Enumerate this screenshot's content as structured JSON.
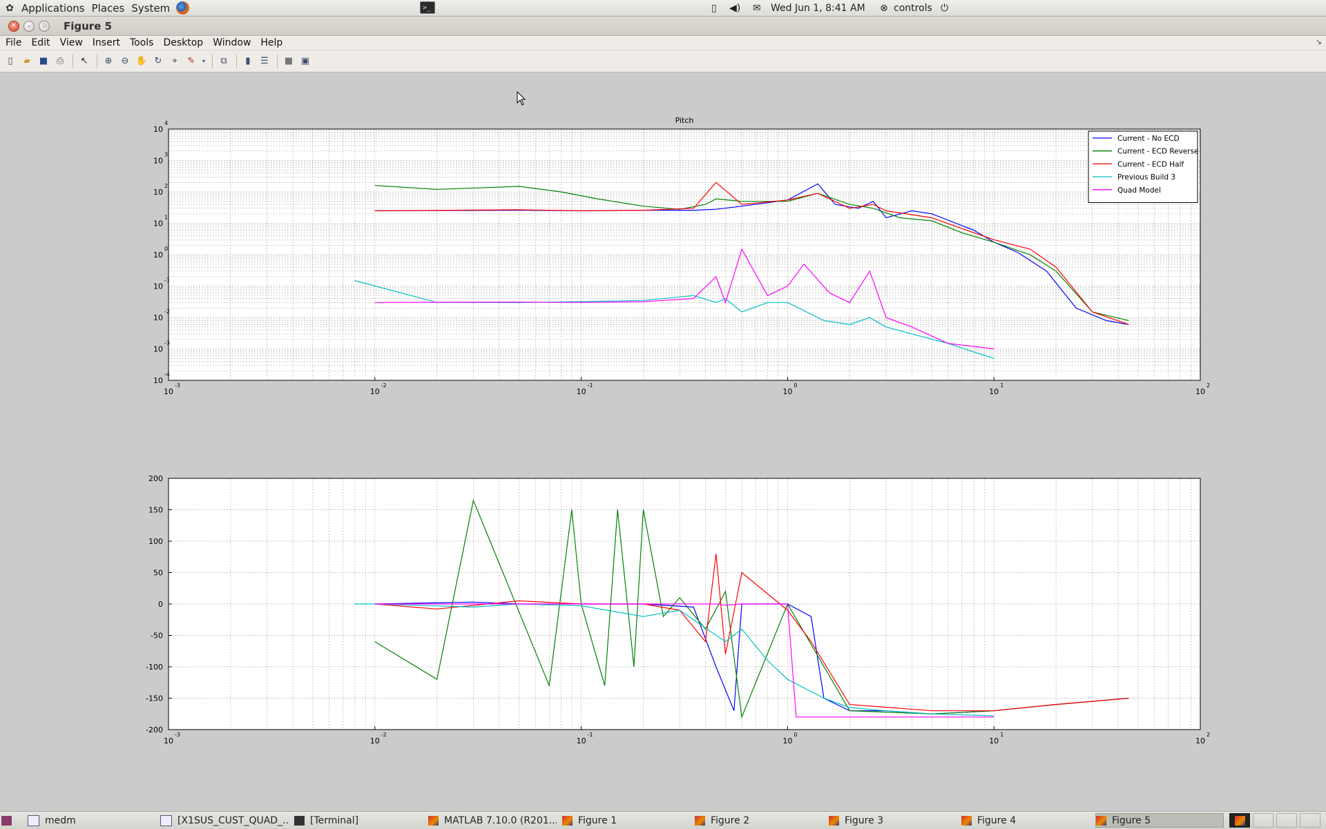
{
  "top_panel": {
    "menus": [
      "Applications",
      "Places",
      "System"
    ],
    "clock": "Wed Jun  1,  8:41 AM",
    "user": "controls"
  },
  "window": {
    "title": "Figure 5"
  },
  "menubar": [
    "File",
    "Edit",
    "View",
    "Insert",
    "Tools",
    "Desktop",
    "Window",
    "Help"
  ],
  "toolbar_icons": [
    "new-figure-icon",
    "open-file-icon",
    "save-icon",
    "print-icon",
    "edit-plot-icon",
    "zoom-in-icon",
    "zoom-out-icon",
    "pan-icon",
    "rotate-3d-icon",
    "data-cursor-icon",
    "brush-icon",
    "link-plot-icon",
    "colorbar-icon",
    "legend-icon",
    "hide-plot-tools-icon",
    "show-plot-tools-icon"
  ],
  "taskbar": {
    "items": [
      "medm",
      "[X1SUS_CUST_QUAD_...",
      "[Terminal]",
      "MATLAB  7.10.0 (R201...",
      "Figure 1",
      "Figure 2",
      "Figure 3",
      "Figure 4",
      "Figure 5"
    ],
    "active": "Figure 5"
  },
  "chart_data": [
    {
      "type": "line",
      "title": "Pitch",
      "xscale": "log",
      "yscale": "log",
      "xlim": [
        0.001,
        100
      ],
      "ylim": [
        0.0001,
        10000
      ],
      "grid": true,
      "legend_position": "top-right",
      "xticks": [
        {
          "base": "10",
          "exp": "-3"
        },
        {
          "base": "10",
          "exp": "-2"
        },
        {
          "base": "10",
          "exp": "-1"
        },
        {
          "base": "10",
          "exp": "0"
        },
        {
          "base": "10",
          "exp": "1"
        },
        {
          "base": "10",
          "exp": "2"
        }
      ],
      "yticks": [
        {
          "base": "10",
          "exp": "-4"
        },
        {
          "base": "10",
          "exp": "-3"
        },
        {
          "base": "10",
          "exp": "-2"
        },
        {
          "base": "10",
          "exp": "-1"
        },
        {
          "base": "10",
          "exp": "0"
        },
        {
          "base": "10",
          "exp": "1"
        },
        {
          "base": "10",
          "exp": "2"
        },
        {
          "base": "10",
          "exp": "3"
        },
        {
          "base": "10",
          "exp": "4"
        }
      ],
      "series": [
        {
          "name": "Current - No ECD",
          "color": "#0000ff",
          "x": [
            0.01,
            0.05,
            0.1,
            0.2,
            0.35,
            0.45,
            0.6,
            1.0,
            1.4,
            1.7,
            2.2,
            2.6,
            3.0,
            4.0,
            5.0,
            8.0,
            10.0,
            13.0,
            18.0,
            25.0,
            35.0,
            45.0
          ],
          "y": [
            25,
            26,
            25,
            26,
            26,
            28,
            35,
            55,
            180,
            40,
            30,
            50,
            15,
            25,
            20,
            6,
            2.5,
            1.2,
            0.3,
            0.02,
            0.008,
            0.006
          ]
        },
        {
          "name": "Current - ECD Reverse",
          "color": "#008000",
          "x": [
            0.01,
            0.02,
            0.05,
            0.08,
            0.12,
            0.2,
            0.3,
            0.4,
            0.45,
            0.6,
            1.0,
            1.4,
            2.0,
            2.6,
            3.5,
            5.0,
            7.0,
            10.0,
            15.0,
            20.0,
            30.0,
            45.0
          ],
          "y": [
            160,
            120,
            150,
            100,
            60,
            35,
            28,
            40,
            60,
            50,
            50,
            90,
            40,
            30,
            15,
            12,
            5,
            2.5,
            1,
            0.3,
            0.015,
            0.008
          ]
        },
        {
          "name": "Current - ECD Half",
          "color": "#ff0000",
          "x": [
            0.01,
            0.05,
            0.1,
            0.2,
            0.35,
            0.45,
            0.6,
            1.0,
            1.4,
            2.0,
            2.6,
            3.0,
            5.0,
            8.0,
            10.0,
            15.0,
            20.0,
            30.0,
            45.0
          ],
          "y": [
            25,
            27,
            25,
            26,
            30,
            200,
            40,
            55,
            90,
            30,
            40,
            25,
            15,
            5,
            3,
            1.5,
            0.4,
            0.015,
            0.006
          ]
        },
        {
          "name": "Previous Build 3",
          "color": "#00bfbf",
          "x": [
            0.008,
            0.015,
            0.02,
            0.05,
            0.1,
            0.2,
            0.35,
            0.45,
            0.5,
            0.6,
            0.8,
            1.0,
            1.5,
            2.0,
            2.5,
            3.0,
            4.0,
            6.0,
            8.0,
            10.0
          ],
          "y": [
            0.15,
            0.05,
            0.03,
            0.03,
            0.032,
            0.035,
            0.05,
            0.03,
            0.04,
            0.015,
            0.03,
            0.03,
            0.008,
            0.006,
            0.01,
            0.005,
            0.003,
            0.0015,
            0.0008,
            0.0005
          ]
        },
        {
          "name": "Quad Model",
          "color": "#ff00ff",
          "x": [
            0.01,
            0.05,
            0.1,
            0.2,
            0.35,
            0.45,
            0.5,
            0.6,
            0.8,
            1.0,
            1.2,
            1.6,
            2.0,
            2.5,
            3.0,
            4.0,
            6.0,
            8.0,
            10.0
          ],
          "y": [
            0.03,
            0.031,
            0.03,
            0.032,
            0.04,
            0.2,
            0.03,
            1.5,
            0.05,
            0.1,
            0.5,
            0.06,
            0.03,
            0.3,
            0.01,
            0.005,
            0.0015,
            0.0012,
            0.001
          ]
        }
      ]
    },
    {
      "type": "line",
      "title": "",
      "xscale": "log",
      "yscale": "linear",
      "xlim": [
        0.001,
        100
      ],
      "ylim": [
        -200,
        200
      ],
      "grid": true,
      "xticks": [
        {
          "base": "10",
          "exp": "-3"
        },
        {
          "base": "10",
          "exp": "-2"
        },
        {
          "base": "10",
          "exp": "-1"
        },
        {
          "base": "10",
          "exp": "0"
        },
        {
          "base": "10",
          "exp": "1"
        },
        {
          "base": "10",
          "exp": "2"
        }
      ],
      "yticks": [
        "200",
        "150",
        "100",
        "50",
        "0",
        "-50",
        "-100",
        "-150",
        "-200"
      ],
      "series": [
        {
          "name": "Current - No ECD",
          "color": "#0000ff",
          "x": [
            0.01,
            0.03,
            0.05,
            0.1,
            0.2,
            0.35,
            0.45,
            0.55,
            0.6,
            1.0,
            1.3,
            1.5,
            2.0,
            3.0,
            5.0,
            10.0,
            20.0,
            45.0
          ],
          "y": [
            0,
            3,
            0,
            0,
            0,
            -5,
            -100,
            -170,
            0,
            0,
            -20,
            -150,
            -170,
            -170,
            -175,
            -170,
            -160,
            -150
          ]
        },
        {
          "name": "Current - ECD Reverse",
          "color": "#008000",
          "x": [
            0.01,
            0.02,
            0.03,
            0.07,
            0.09,
            0.1,
            0.13,
            0.15,
            0.18,
            0.2,
            0.25,
            0.3,
            0.4,
            0.5,
            0.6,
            1.0,
            2.0,
            5.0,
            10.0,
            20.0,
            45.0
          ],
          "y": [
            -60,
            -120,
            165,
            -130,
            150,
            0,
            -130,
            150,
            -100,
            150,
            -20,
            10,
            -40,
            20,
            -180,
            0,
            -170,
            -175,
            -170,
            -160,
            -150
          ]
        },
        {
          "name": "Current - ECD Half",
          "color": "#ff0000",
          "x": [
            0.01,
            0.02,
            0.05,
            0.1,
            0.2,
            0.3,
            0.4,
            0.45,
            0.5,
            0.6,
            1.0,
            1.3,
            2.0,
            5.0,
            10.0,
            20.0,
            45.0
          ],
          "y": [
            0,
            -8,
            5,
            0,
            0,
            -10,
            -60,
            80,
            -80,
            50,
            -10,
            -60,
            -160,
            -170,
            -170,
            -160,
            -150
          ]
        },
        {
          "name": "Previous Build 3",
          "color": "#00bfbf",
          "x": [
            0.008,
            0.01,
            0.03,
            0.05,
            0.1,
            0.2,
            0.3,
            0.5,
            0.6,
            0.8,
            1.0,
            1.5,
            2.0,
            3.0,
            5.0,
            10.0
          ],
          "y": [
            0,
            0,
            -5,
            0,
            -3,
            -20,
            -10,
            -60,
            -40,
            -90,
            -120,
            -150,
            -165,
            -170,
            -175,
            -178
          ]
        },
        {
          "name": "Quad Model",
          "color": "#ff00ff",
          "x": [
            0.01,
            0.05,
            0.1,
            0.2,
            0.3,
            0.45,
            0.5,
            0.6,
            1.0,
            1.1,
            2.0,
            2.5,
            3.0,
            5.0,
            10.0
          ],
          "y": [
            0,
            0,
            0,
            0,
            0,
            0,
            -2,
            0,
            0,
            -180,
            -180,
            -180,
            -180,
            -180,
            -180
          ]
        }
      ]
    }
  ]
}
